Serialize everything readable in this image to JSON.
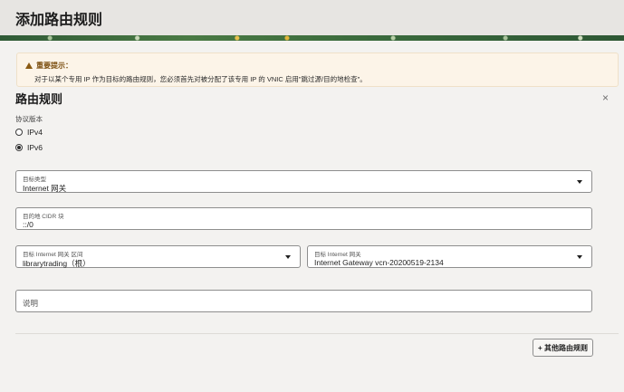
{
  "page": {
    "title": "添加路由规则"
  },
  "notice": {
    "title": "重要提示：",
    "text": "对于以某个专用 IP 作为目标的路由规则，您必须首先对被分配了该专用 IP 的 VNIC 启用\"跳过源/目的地检查\"。"
  },
  "section": {
    "title": "路由规则",
    "close_icon": "×"
  },
  "protocol": {
    "label": "协议版本",
    "options": [
      {
        "label": "IPv4",
        "selected": false
      },
      {
        "label": "IPv6",
        "selected": true
      }
    ]
  },
  "target_type": {
    "label": "目标类型",
    "value": "Internet 网关"
  },
  "destination_cidr": {
    "label": "目的地 CIDR 块",
    "value": "::/0"
  },
  "target_compartment": {
    "label": "目标 Internet 网关 区间",
    "value": "librarytrading（根）"
  },
  "target_gateway": {
    "label": "目标 Internet 网关",
    "value": "Internet Gateway vcn-20200519-2134"
  },
  "description": {
    "placeholder": "说明"
  },
  "actions": {
    "add_rule": "+ 其他路由规则"
  },
  "colors": {
    "header_bg": "#e7e5e2",
    "page_bg": "#f3f2f0",
    "notice_bg": "#fcf4e8",
    "warning": "#8a5a12"
  }
}
